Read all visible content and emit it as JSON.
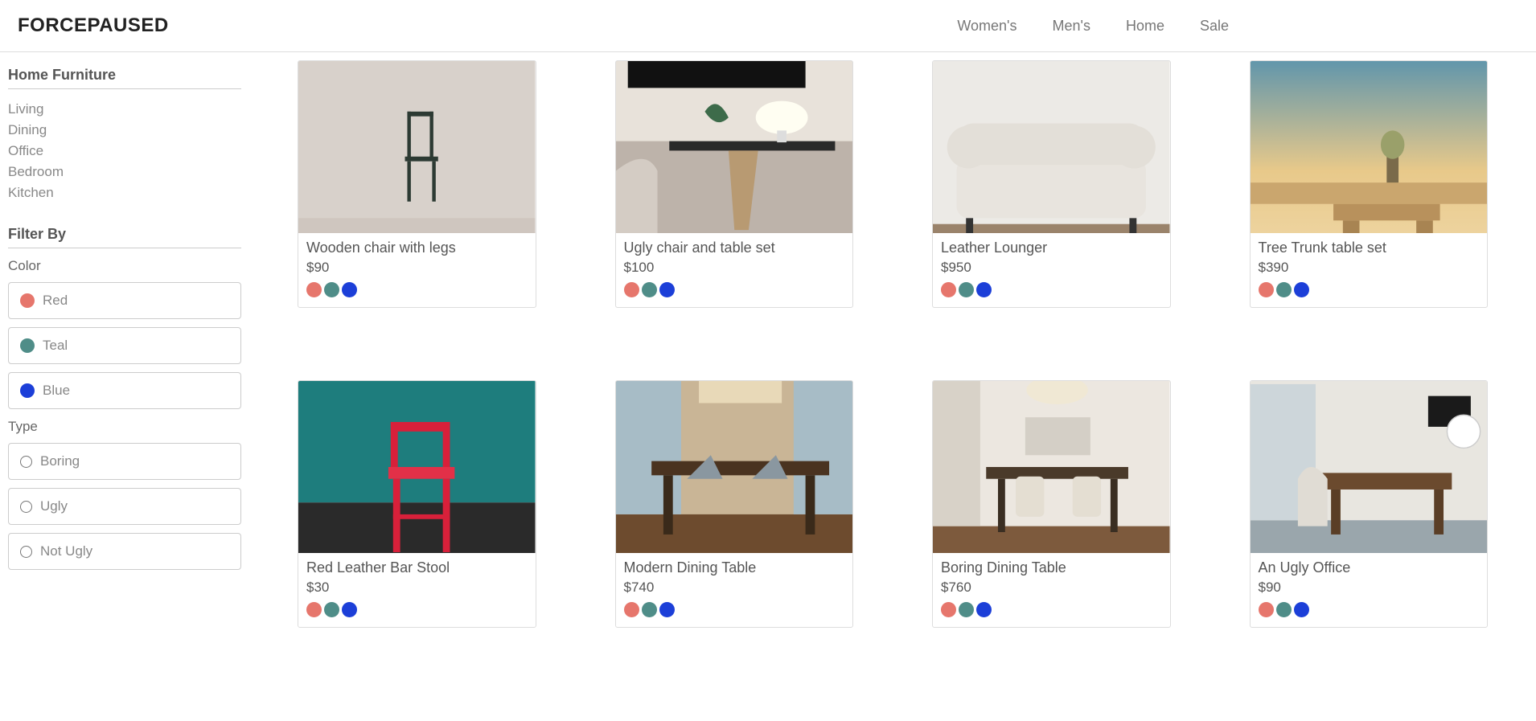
{
  "brand": "FORCEPAUSED",
  "nav": [
    "Women's",
    "Men's",
    "Home",
    "Sale"
  ],
  "sidebar": {
    "heading": "Home Furniture",
    "categories": [
      "Living",
      "Dining",
      "Office",
      "Bedroom",
      "Kitchen"
    ],
    "filter_heading": "Filter By",
    "color_label": "Color",
    "colors": [
      {
        "label": "Red",
        "hex": "#e6766c"
      },
      {
        "label": "Teal",
        "hex": "#4f8d88"
      },
      {
        "label": "Blue",
        "hex": "#1c3fd8"
      }
    ],
    "type_label": "Type",
    "types": [
      "Boring",
      "Ugly",
      "Not Ugly"
    ]
  },
  "swatch_colors": [
    "#e6766c",
    "#4f8d88",
    "#1c3fd8"
  ],
  "products": [
    {
      "title": "Wooden chair with legs",
      "price": "$90"
    },
    {
      "title": "Ugly chair and table set",
      "price": "$100"
    },
    {
      "title": "Leather Lounger",
      "price": "$950"
    },
    {
      "title": "Tree Trunk table set",
      "price": "$390"
    },
    {
      "title": "Red Leather Bar Stool",
      "price": "$30"
    },
    {
      "title": "Modern Dining Table",
      "price": "$740"
    },
    {
      "title": "Boring Dining Table",
      "price": "$760"
    },
    {
      "title": "An Ugly Office",
      "price": "$90"
    }
  ]
}
